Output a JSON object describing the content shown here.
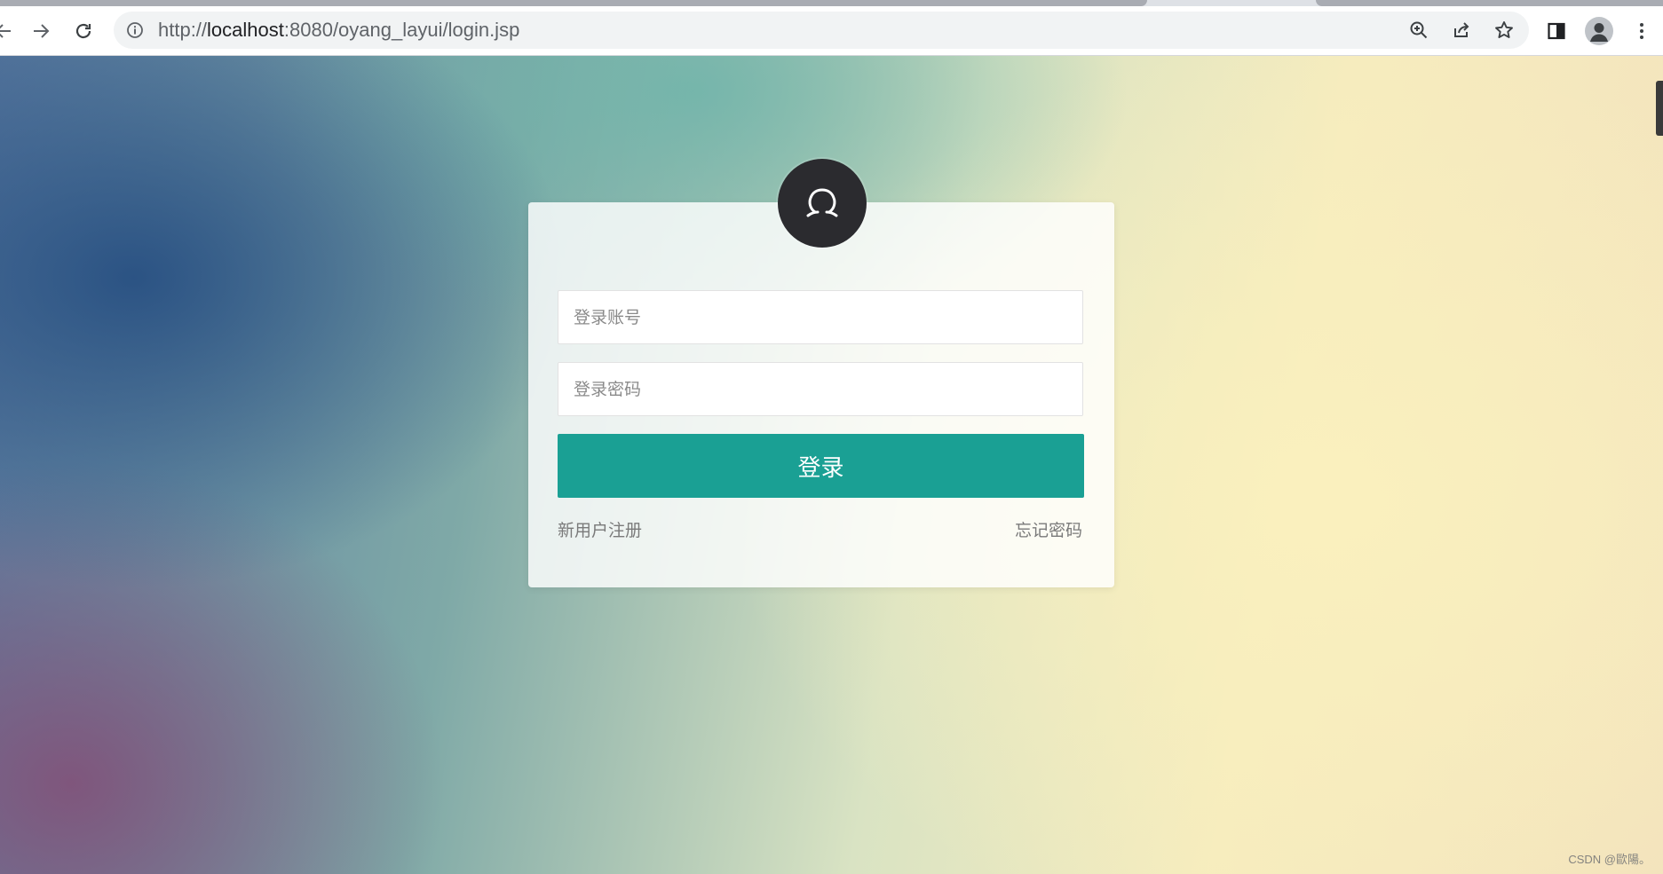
{
  "browser": {
    "url_scheme": "http://",
    "url_host": "localhost",
    "url_rest": ":8080/oyang_layui/login.jsp"
  },
  "login": {
    "account_placeholder": "登录账号",
    "password_placeholder": "登录密码",
    "submit_label": "登录",
    "register_link": "新用户注册",
    "forgot_link": "忘记密码"
  },
  "watermark": "CSDN @歐陽。",
  "colors": {
    "primary": "#1aa094",
    "avatar_bg": "#2b2b2f"
  },
  "icons": {
    "back": "arrow-left-icon",
    "forward": "arrow-right-icon",
    "reload": "reload-icon",
    "site_info": "info-icon",
    "zoom": "zoom-in-icon",
    "share": "share-icon",
    "bookmark": "star-icon",
    "side_panel": "side-panel-icon",
    "profile": "profile-icon",
    "menu": "kebab-menu-icon",
    "login_avatar": "user-icon"
  }
}
